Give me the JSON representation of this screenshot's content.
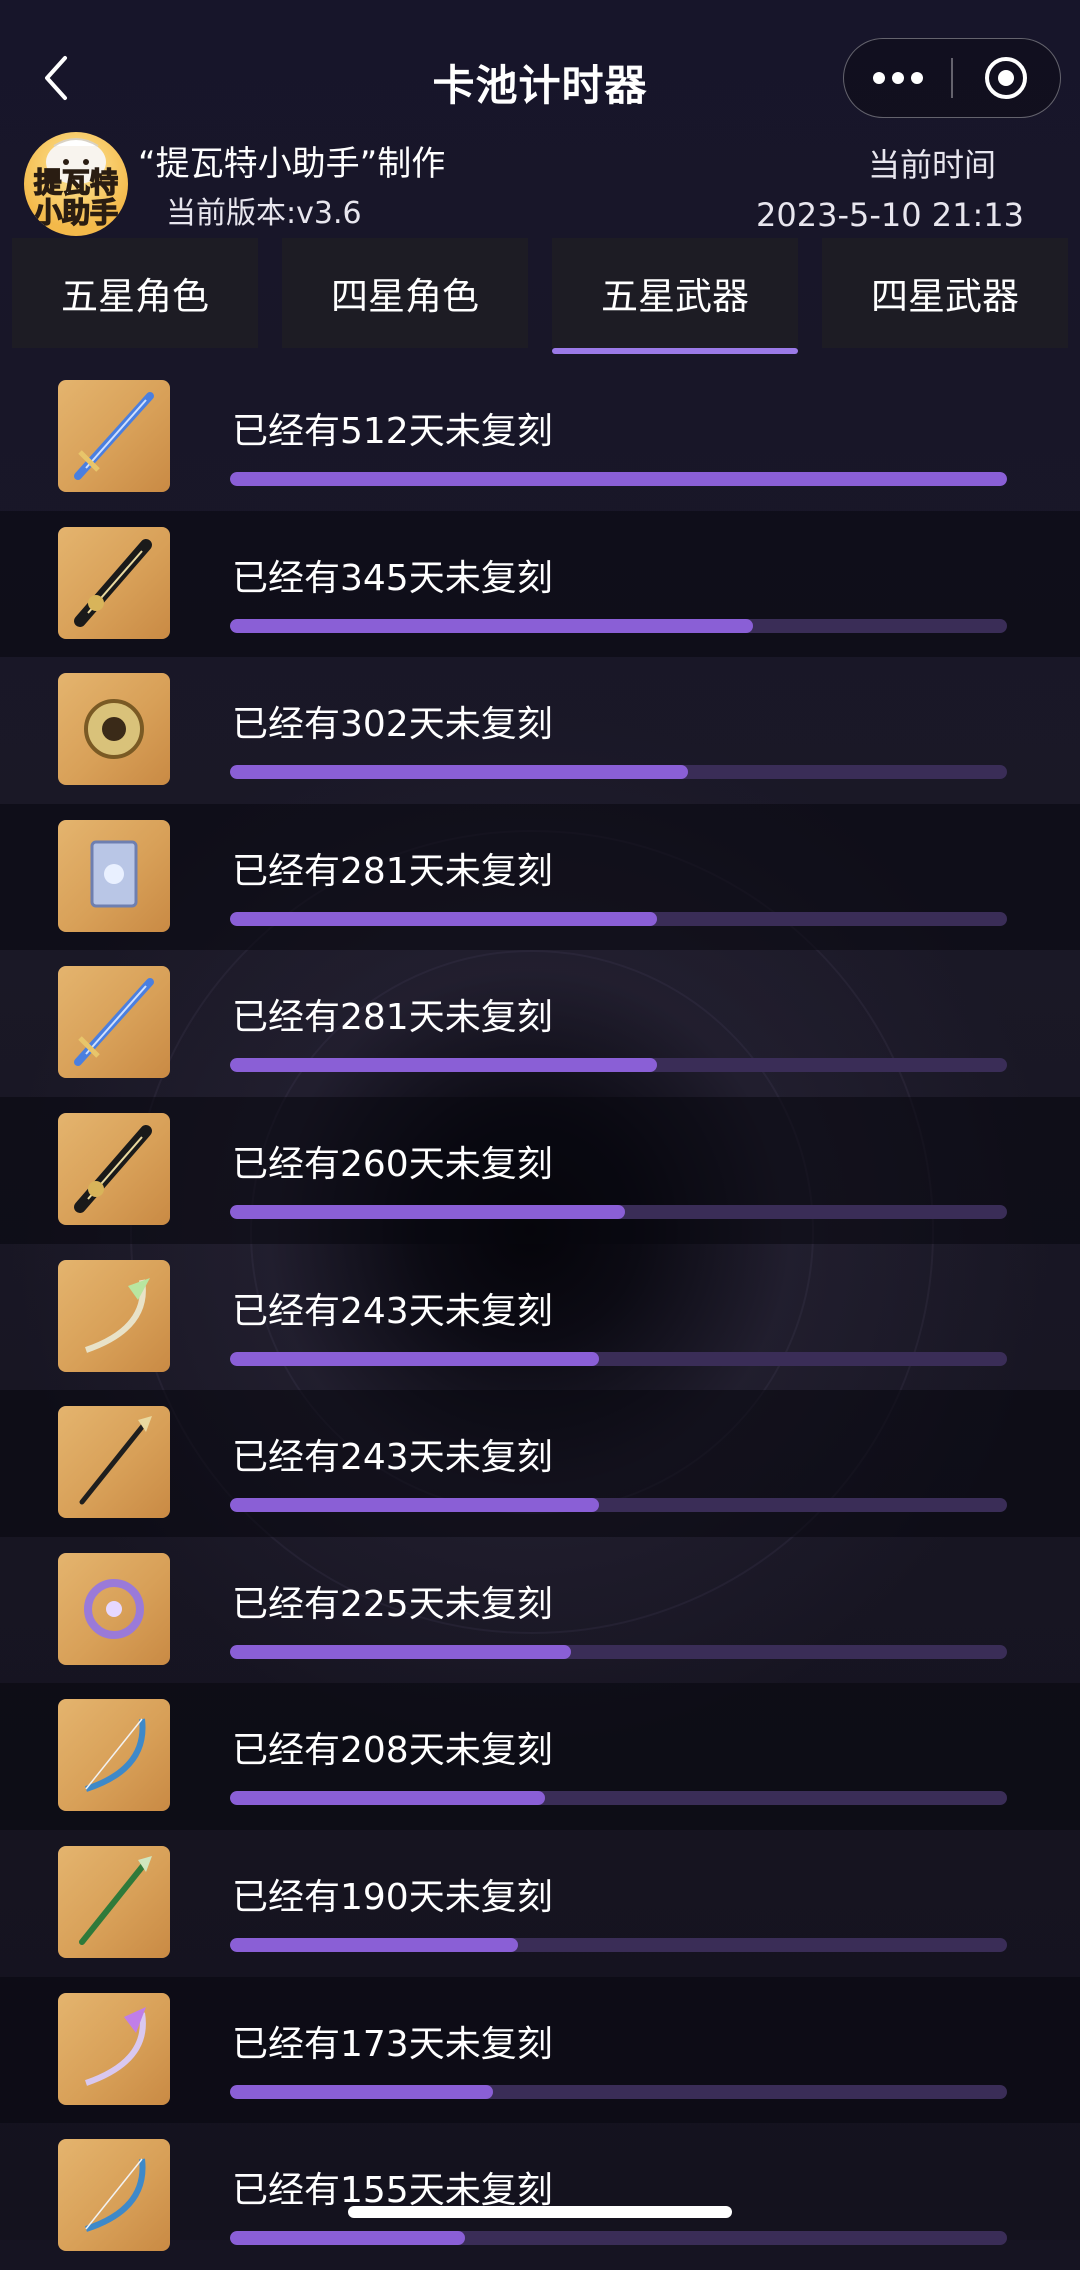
{
  "nav": {
    "title": "卡池计时器"
  },
  "header": {
    "logo_lines": [
      "提瓦特",
      "小助手"
    ],
    "maker": "“提瓦特小助手”制作",
    "version": "当前版本:v3.6",
    "time_label": "当前时间",
    "time_value": "2023-5-10 21:13"
  },
  "tabs": [
    {
      "label": "五星角色",
      "active": false
    },
    {
      "label": "四星角色",
      "active": false
    },
    {
      "label": "五星武器",
      "active": true
    },
    {
      "label": "四星武器",
      "active": false
    }
  ],
  "colors": {
    "accent": "#8a5fd6",
    "track": "#3a2d57",
    "background": "#161422"
  },
  "items": [
    {
      "text": "已经有512天未复刻",
      "progress": 1.0,
      "icon": "sword-blue-icon"
    },
    {
      "text": "已经有345天未复刻",
      "progress": 0.673,
      "icon": "claymore-black-gold-icon"
    },
    {
      "text": "已经有302天未复刻",
      "progress": 0.59,
      "icon": "catalyst-gold-icon"
    },
    {
      "text": "已经有281天未复刻",
      "progress": 0.549,
      "icon": "catalyst-book-icon"
    },
    {
      "text": "已经有281天未复刻",
      "progress": 0.549,
      "icon": "sword-light-blue-icon"
    },
    {
      "text": "已经有260天未复刻",
      "progress": 0.508,
      "icon": "claymore-dark-icon"
    },
    {
      "text": "已经有243天未复刻",
      "progress": 0.475,
      "icon": "bow-green-icon"
    },
    {
      "text": "已经有243天未复刻",
      "progress": 0.475,
      "icon": "polearm-black-icon"
    },
    {
      "text": "已经有225天未复刻",
      "progress": 0.439,
      "icon": "catalyst-purple-icon"
    },
    {
      "text": "已经有208天未复刻",
      "progress": 0.406,
      "icon": "bow-blue-icon"
    },
    {
      "text": "已经有190天未复刻",
      "progress": 0.371,
      "icon": "polearm-green-icon"
    },
    {
      "text": "已经有173天未复刻",
      "progress": 0.338,
      "icon": "bow-purple-icon"
    },
    {
      "text": "已经有155天未复刻",
      "progress": 0.303,
      "icon": "bow-light-icon"
    }
  ]
}
